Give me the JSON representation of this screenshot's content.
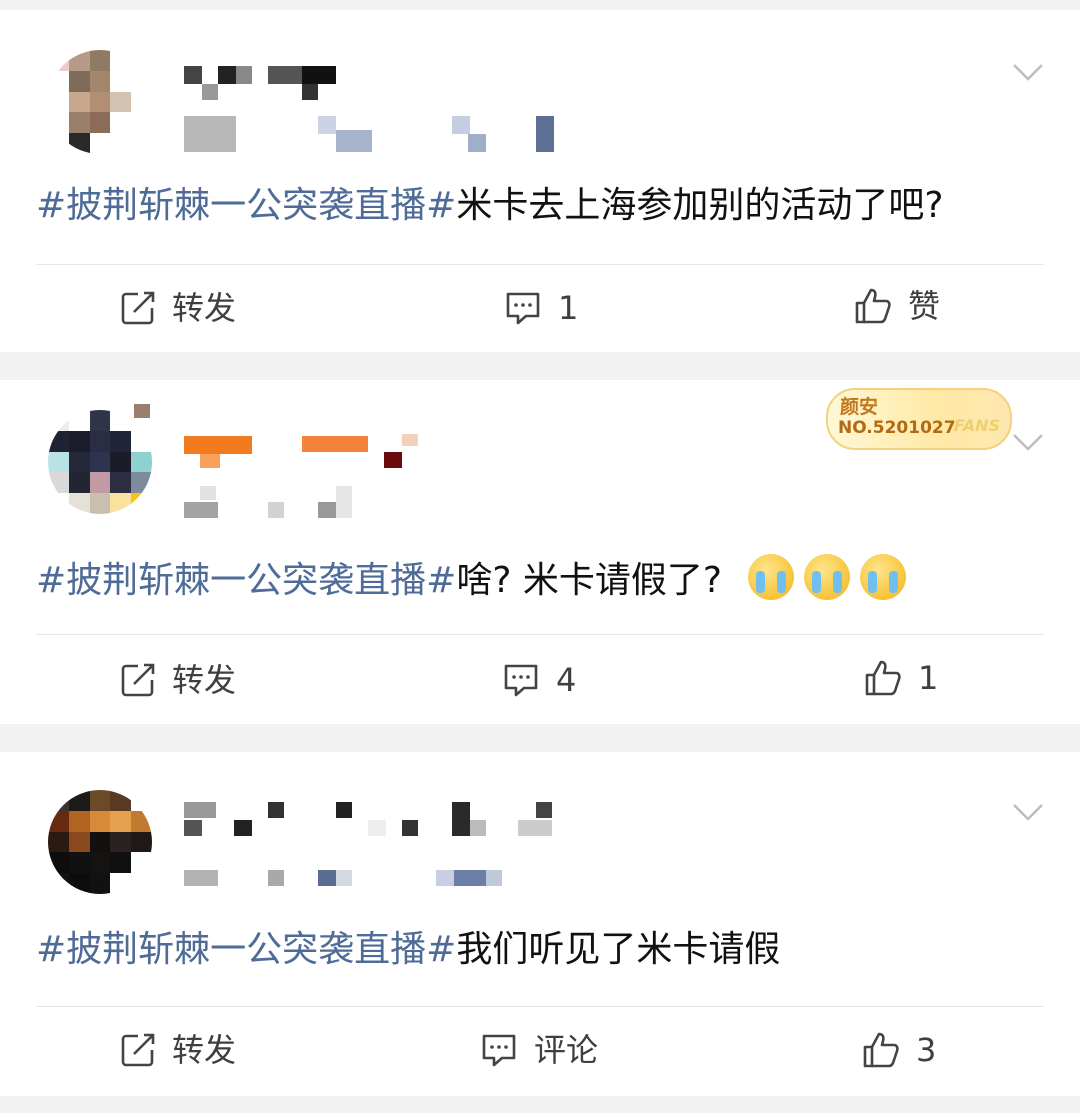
{
  "posts": [
    {
      "text_tag": "#披荆斩棘一公突袭直播#",
      "text_body": "米卡去上海参加别的活动了吧?",
      "actions": {
        "repost": "转发",
        "comment": "1",
        "like": "赞"
      }
    },
    {
      "badge": {
        "name": "颜安",
        "number": "NO.5201027",
        "fans": "FANS"
      },
      "text_tag": "#披荆斩棘一公突袭直播#",
      "text_body": "啥? 米卡请假了?",
      "emoji_icons": [
        "crying-face-icon",
        "crying-face-icon",
        "crying-face-icon"
      ],
      "actions": {
        "repost": "转发",
        "comment": "4",
        "like": "1"
      }
    },
    {
      "text_tag": "#披荆斩棘一公突袭直播#",
      "text_body": "我们听见了米卡请假",
      "actions": {
        "repost": "转发",
        "comment": "评论",
        "like": "3"
      }
    }
  ],
  "colors": {
    "hashtag": "#4f6b97",
    "text": "#111111",
    "action_text": "#3f3f3f",
    "background": "#f2f2f2",
    "card": "#ffffff"
  }
}
